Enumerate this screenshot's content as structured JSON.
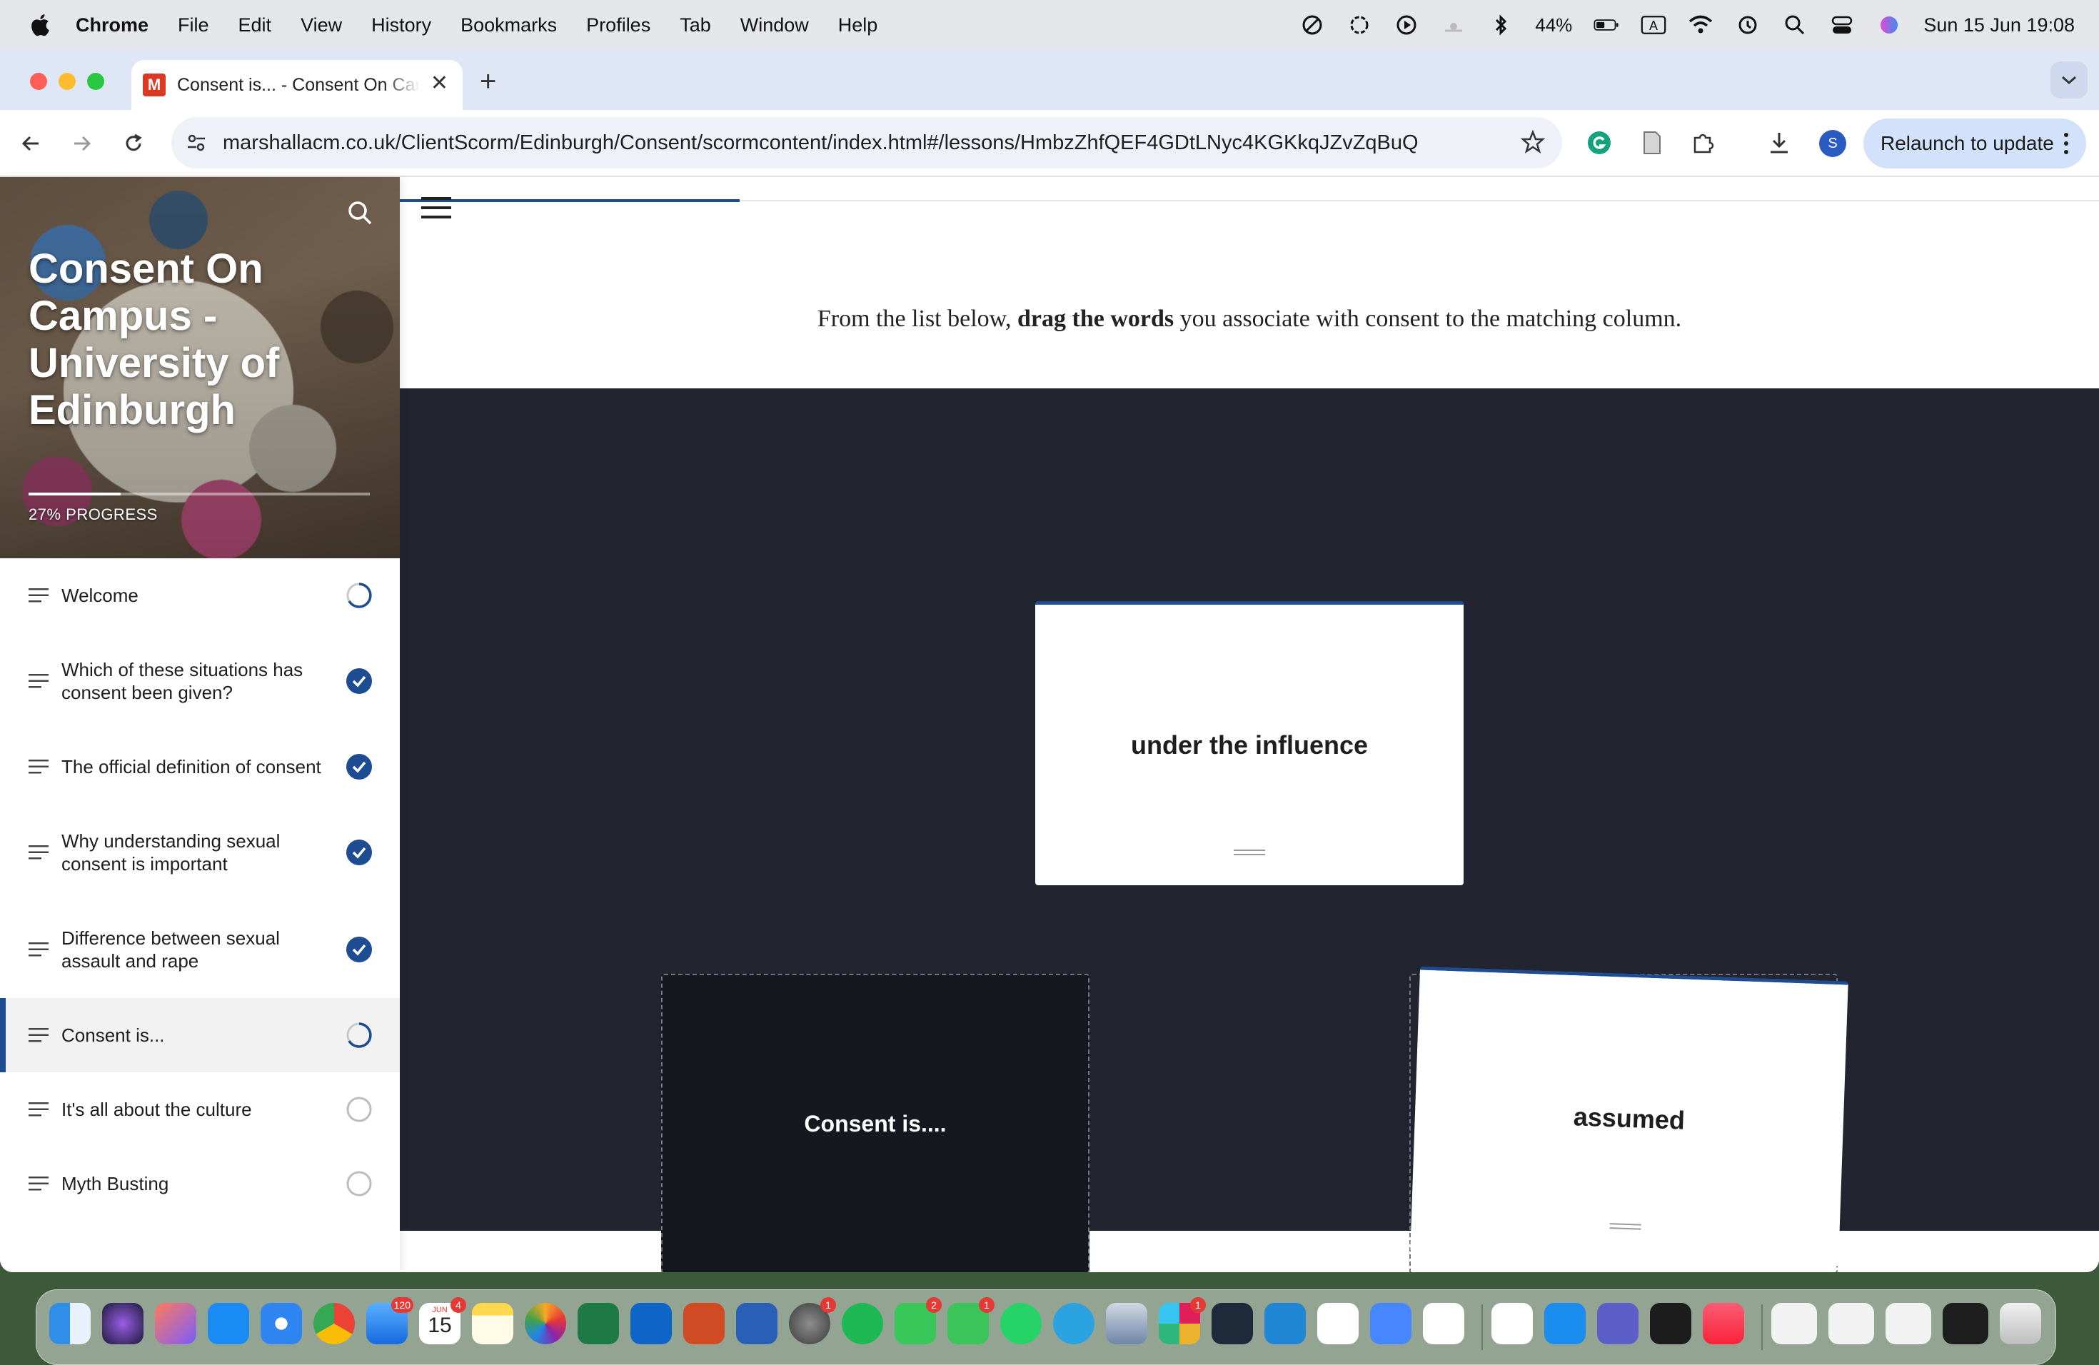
{
  "menubar": {
    "app_name": "Chrome",
    "items": [
      "File",
      "Edit",
      "View",
      "History",
      "Bookmarks",
      "Profiles",
      "Tab",
      "Window",
      "Help"
    ],
    "battery": "44%",
    "clock": "Sun 15 Jun  19:08"
  },
  "browser": {
    "tab_title": "Consent is... - Consent On Campus - University of Edinburgh",
    "tab_favicon_letter": "M",
    "url": "marshallacm.co.uk/ClientScorm/Edinburgh/Consent/scormcontent/index.html#/lessons/HmbzZhfQEF4GDtLNyc4KGKkqJZvZqBuQ",
    "profile_initial": "S",
    "relaunch_label": "Relaunch to update"
  },
  "course": {
    "title": "Consent On Campus - University of Edinburgh",
    "progress_label": "27% PROGRESS",
    "progress": 0.27,
    "lessons": [
      {
        "label": "Welcome",
        "status": "in-progress"
      },
      {
        "label": "Which of these situations has consent been given?",
        "status": "complete"
      },
      {
        "label": "The official definition of consent",
        "status": "complete"
      },
      {
        "label": "Why understanding sexual consent is important",
        "status": "complete"
      },
      {
        "label": "Difference between sexual assault and rape",
        "status": "complete"
      },
      {
        "label": "Consent is...",
        "status": "in-progress",
        "active": true
      },
      {
        "label": "It's all about the culture",
        "status": "not-started"
      },
      {
        "label": "Myth Busting",
        "status": "not-started"
      }
    ]
  },
  "lesson": {
    "instruction_pre": "From the list below, ",
    "instruction_bold": "drag the words",
    "instruction_post": " you associate with consent to the matching column.",
    "lesson_progress": 0.2,
    "draggable_card": "under the influence",
    "drop_zone_label": "Consent is....",
    "dragging_card": "assumed"
  },
  "dock": {
    "badges": {
      "mail": "120",
      "calendar_month": "JUN",
      "calendar_day": "15",
      "calendar_badge": "4",
      "settings": "1",
      "messages": "2",
      "facetime": "1",
      "slack": "1"
    }
  },
  "colors": {
    "accent": "#1e4c93",
    "stage_bg": "#22252f"
  }
}
